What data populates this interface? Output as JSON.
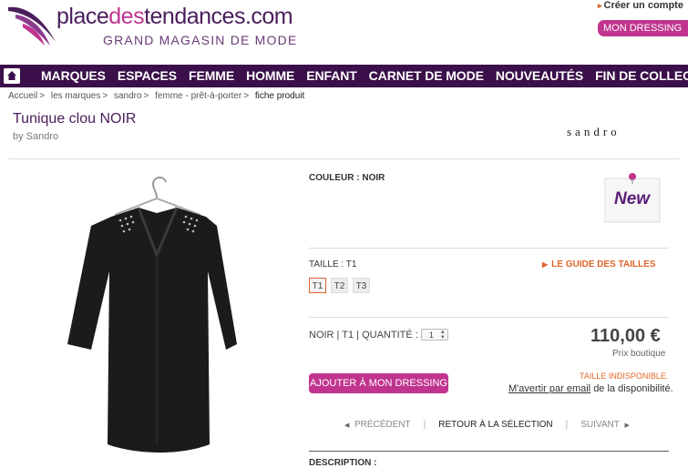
{
  "header": {
    "logo_part1": "place",
    "logo_part2": "des",
    "logo_part3": "tendances.com",
    "tagline": "GRAND MAGASIN DE MODE",
    "create_account": "Créer un compte",
    "mon_dressing": "MON DRESSING"
  },
  "nav": {
    "items": [
      "MARQUES",
      "ESPACES",
      "FEMME",
      "HOMME",
      "ENFANT",
      "CARNET DE MODE",
      "NOUVEAUTÉS",
      "FIN DE COLLEC"
    ]
  },
  "breadcrumb": [
    "Accueil",
    "les marques",
    "sandro",
    "femme - prêt-à-porter",
    "fiche produit"
  ],
  "product": {
    "title": "Tunique clou NOIR",
    "byline": "by Sandro",
    "brand_logo": "sandro",
    "couleur_label": "COULEUR :",
    "couleur_value": "NOIR",
    "new_badge": "New",
    "taille_label": "TAILLE :",
    "taille_value": "T1",
    "guide_label": "LE GUIDE DES TAILLES",
    "sizes": [
      "T1",
      "T2",
      "T3"
    ],
    "selected_size": "T1",
    "summary": "NOIR | T1 | QUANTITÉ :",
    "quantity": "1",
    "price": "110,00 €",
    "price_note": "Prix boutique",
    "add_button": "AJOUTER À MON DRESSING",
    "unavailable": "TAILLE INDISPONIBLE.",
    "notify_link": "M'avertir par email",
    "notify_rest": "de la disponibilité.",
    "prev": "PRÉCÉDENT",
    "back": "RETOUR À LA SÉLECTION",
    "next": "SUIVANT",
    "description_label": "DESCRIPTION :"
  },
  "colors": {
    "nav_bg": "#3b0f4a",
    "accent_pink": "#c0348e",
    "accent_orange": "#e0642a",
    "brand_purple": "#4a1e5c"
  }
}
